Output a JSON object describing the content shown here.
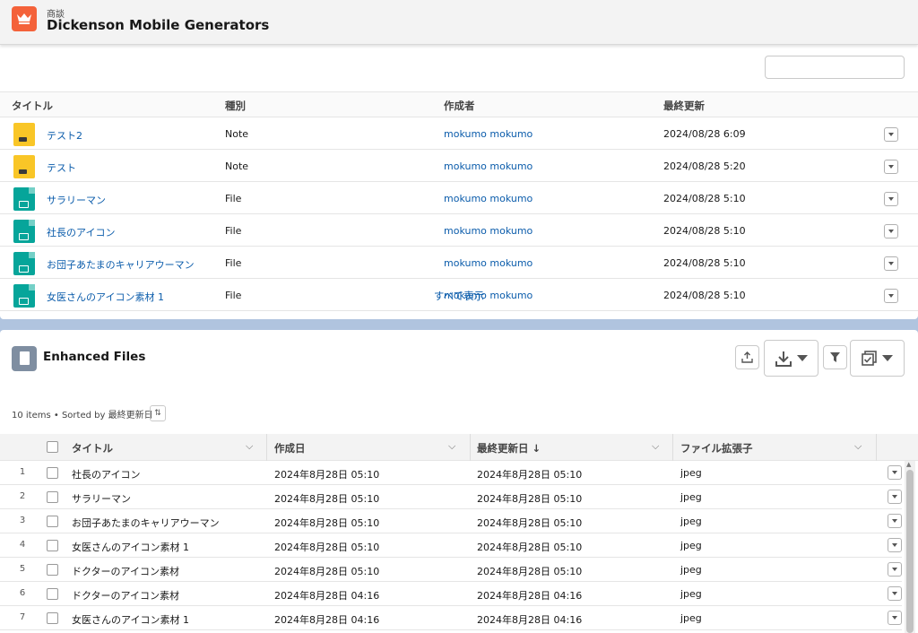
{
  "header": {
    "object_type": "商談",
    "record_name": "Dickenson Mobile Generators"
  },
  "files_list": {
    "columns": [
      "タイトル",
      "種別",
      "作成者",
      "最終更新"
    ],
    "rows": [
      {
        "title": "テスト2",
        "type": "Note",
        "owner": "mokumo mokumo",
        "modified": "2024/08/28 6:09",
        "icon": "note-icon"
      },
      {
        "title": "テスト",
        "type": "Note",
        "owner": "mokumo mokumo",
        "modified": "2024/08/28 5:20",
        "icon": "note-icon"
      },
      {
        "title": "サラリーマン",
        "type": "File",
        "owner": "mokumo mokumo",
        "modified": "2024/08/28 5:10",
        "icon": "image-file-icon"
      },
      {
        "title": "社長のアイコン",
        "type": "File",
        "owner": "mokumo mokumo",
        "modified": "2024/08/28 5:10",
        "icon": "image-file-icon"
      },
      {
        "title": "お団子あたまのキャリアウーマン",
        "type": "File",
        "owner": "mokumo mokumo",
        "modified": "2024/08/28 5:10",
        "icon": "image-file-icon"
      },
      {
        "title": "女医さんのアイコン素材 1",
        "type": "File",
        "owner": "mokumo mokumo",
        "modified": "2024/08/28 5:10",
        "icon": "image-file-icon"
      }
    ],
    "view_all": "すべて表示"
  },
  "enhanced_files": {
    "title": "Enhanced Files",
    "meta": "10 items • Sorted by 最終更新日",
    "columns": [
      "タイトル",
      "作成日",
      "最終更新日 ↓",
      "ファイル拡張子"
    ],
    "rows": [
      {
        "num": "1",
        "title": "社長のアイコン",
        "created": "2024年8月28日 05:10",
        "modified": "2024年8月28日 05:10",
        "ext": "jpeg"
      },
      {
        "num": "2",
        "title": "サラリーマン",
        "created": "2024年8月28日 05:10",
        "modified": "2024年8月28日 05:10",
        "ext": "jpeg"
      },
      {
        "num": "3",
        "title": "お団子あたまのキャリアウーマン",
        "created": "2024年8月28日 05:10",
        "modified": "2024年8月28日 05:10",
        "ext": "jpeg"
      },
      {
        "num": "4",
        "title": "女医さんのアイコン素材 1",
        "created": "2024年8月28日 05:10",
        "modified": "2024年8月28日 05:10",
        "ext": "jpeg"
      },
      {
        "num": "5",
        "title": "ドクターのアイコン素材",
        "created": "2024年8月28日 05:10",
        "modified": "2024年8月28日 05:10",
        "ext": "jpeg"
      },
      {
        "num": "6",
        "title": "ドクターのアイコン素材",
        "created": "2024年8月28日 04:16",
        "modified": "2024年8月28日 04:16",
        "ext": "jpeg"
      },
      {
        "num": "7",
        "title": "女医さんのアイコン素材 1",
        "created": "2024年8月28日 04:16",
        "modified": "2024年8月28日 04:16",
        "ext": "jpeg"
      }
    ]
  },
  "colors": {
    "accent": "#0b5cab",
    "app_icon": "#f4623a",
    "note_icon": "#f9c627",
    "file_icon": "#06a59a"
  }
}
